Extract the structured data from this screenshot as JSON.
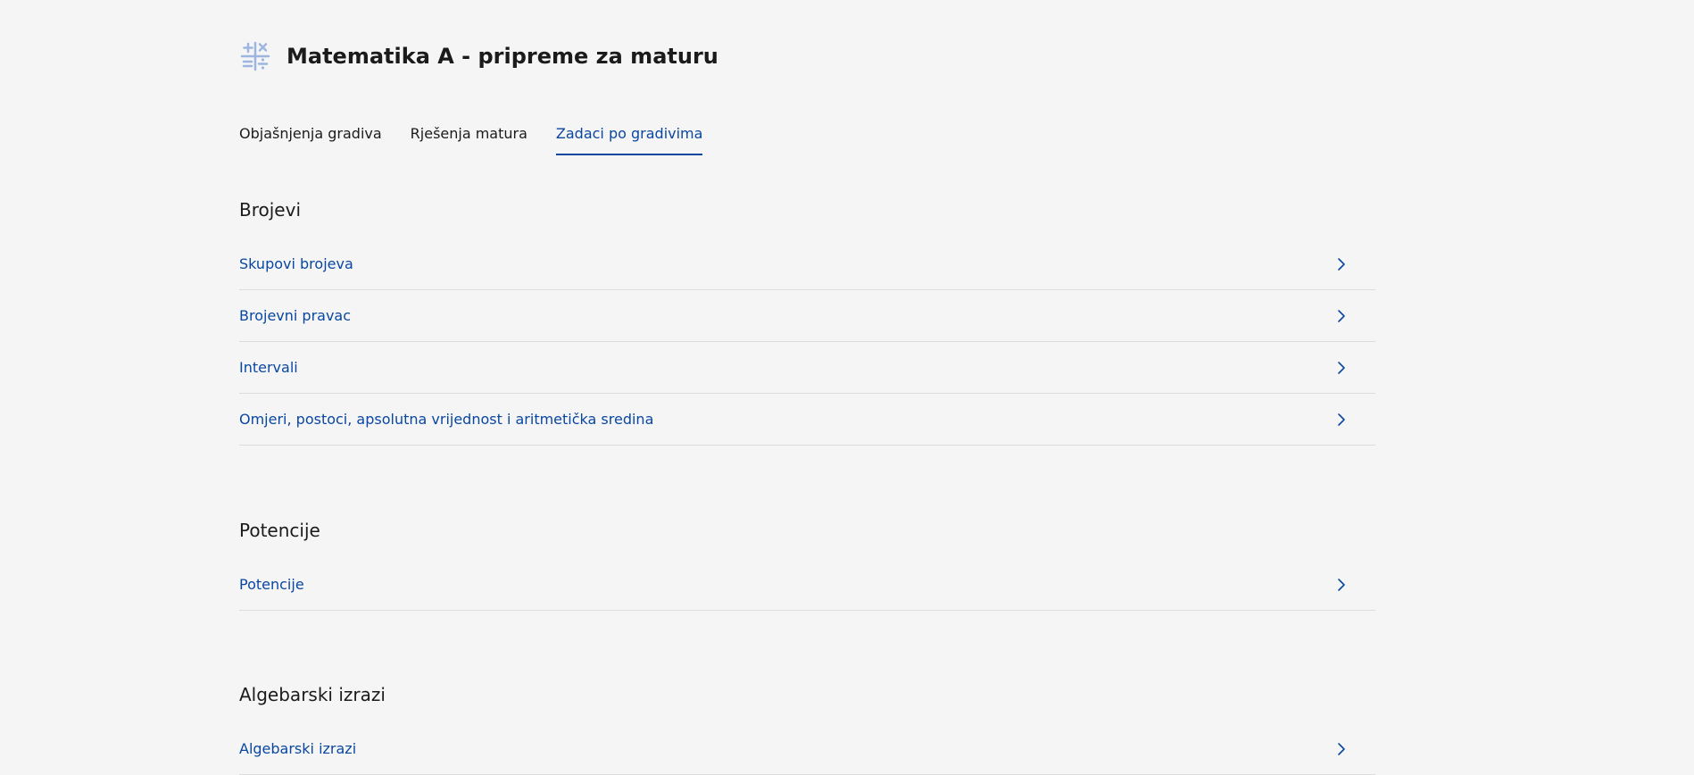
{
  "header": {
    "title": "Matematika A - pripreme za maturu",
    "icon": "math-operators-icon",
    "icon_color": "#9cb6e0"
  },
  "tabs": [
    {
      "label": "Objašnjenja gradiva",
      "active": false
    },
    {
      "label": "Rješenja matura",
      "active": false
    },
    {
      "label": "Zadaci po gradivima",
      "active": true
    }
  ],
  "colors": {
    "accent": "#0a47a1",
    "background": "#f5f5f5",
    "divider": "#dcdcdc"
  },
  "sections": [
    {
      "heading": "Brojevi",
      "topics": [
        {
          "label": "Skupovi brojeva"
        },
        {
          "label": "Brojevni pravac"
        },
        {
          "label": "Intervali"
        },
        {
          "label": "Omjeri, postoci, apsolutna vrijednost i aritmetička sredina"
        }
      ]
    },
    {
      "heading": "Potencije",
      "topics": [
        {
          "label": "Potencije"
        }
      ]
    },
    {
      "heading": "Algebarski izrazi",
      "topics": [
        {
          "label": "Algebarski izrazi"
        }
      ]
    }
  ]
}
